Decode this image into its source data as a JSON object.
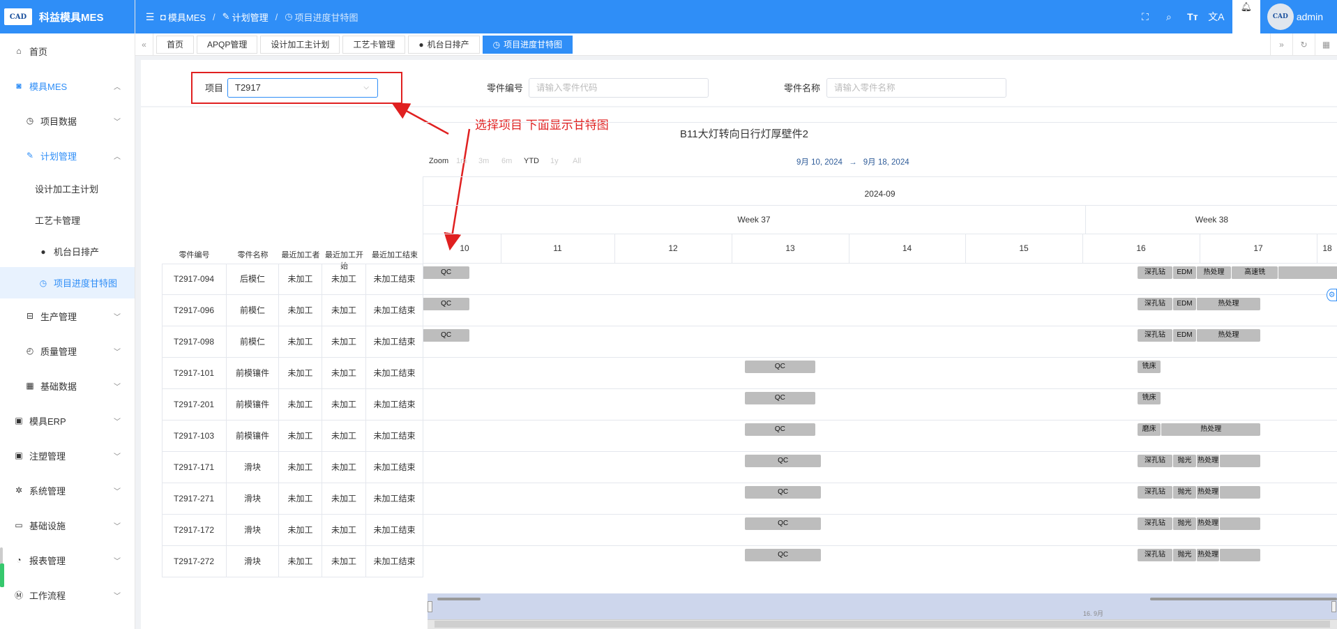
{
  "app": {
    "logo_text": "CAD",
    "logo_sub": "科益模具MES"
  },
  "sidebar": {
    "items": [
      {
        "label": "首页",
        "icon": "home-icon"
      },
      {
        "label": "模具MES",
        "icon": "camera-icon"
      },
      {
        "label": "项目数据",
        "icon": "clock-icon"
      },
      {
        "label": "计划管理",
        "icon": "edit-icon"
      },
      {
        "label": "设计加工主计划"
      },
      {
        "label": "工艺卡管理"
      },
      {
        "label": "机台日排产",
        "icon": "user-icon"
      },
      {
        "label": "项目进度甘特图",
        "icon": "clock-icon"
      },
      {
        "label": "生产管理",
        "icon": "toolbox-icon"
      },
      {
        "label": "质量管理",
        "icon": "timer-icon"
      },
      {
        "label": "基础数据",
        "icon": "calendar-icon"
      },
      {
        "label": "模具ERP",
        "icon": "bag-icon"
      },
      {
        "label": "注塑管理",
        "icon": "bag-icon"
      },
      {
        "label": "系统管理",
        "icon": "gear-icon"
      },
      {
        "label": "基础设施",
        "icon": "monitor-icon"
      },
      {
        "label": "报表管理",
        "icon": "pie-icon"
      },
      {
        "label": "工作流程",
        "icon": "flow-icon"
      }
    ]
  },
  "header": {
    "breadcrumb": [
      "模具MES",
      "计划管理",
      "项目进度甘特图"
    ],
    "user": "admin"
  },
  "tabs": [
    "首页",
    "APQP管理",
    "设计加工主计划",
    "工艺卡管理",
    "机台日排产",
    "项目进度甘特图"
  ],
  "filters": {
    "project_label": "项目",
    "project_value": "T2917",
    "part_no_label": "零件编号",
    "part_no_placeholder": "请输入零件代码",
    "part_name_label": "零件名称",
    "part_name_placeholder": "请输入零件名称"
  },
  "annotation": "选择项目 下面显示甘特图",
  "gantt": {
    "title": "B11大灯转向日行灯厚壁件2",
    "zoom_label": "Zoom",
    "zoom_options": [
      "1m",
      "3m",
      "6m",
      "YTD",
      "1y",
      "All"
    ],
    "zoom_active": "YTD",
    "range_from": "9月 10, 2024",
    "range_sep": "→",
    "range_to": "9月 18, 2024",
    "month_label": "2024-09",
    "weeks": [
      "Week 37",
      "Week 38"
    ],
    "days": [
      "10",
      "11",
      "12",
      "13",
      "14",
      "15",
      "16",
      "17",
      "18"
    ],
    "navigator_label": "16. 9月"
  },
  "table": {
    "headers": [
      "零件编号",
      "零件名称",
      "最近加工者",
      "最近加工开始",
      "最近加工结束"
    ],
    "rows": [
      [
        "T2917-094",
        "后模仁",
        "未加工",
        "未加工",
        "未加工结束"
      ],
      [
        "T2917-096",
        "前模仁",
        "未加工",
        "未加工",
        "未加工结束"
      ],
      [
        "T2917-098",
        "前模仁",
        "未加工",
        "未加工",
        "未加工结束"
      ],
      [
        "T2917-101",
        "前模镶件",
        "未加工",
        "未加工",
        "未加工结束"
      ],
      [
        "T2917-201",
        "前模镶件",
        "未加工",
        "未加工",
        "未加工结束"
      ],
      [
        "T2917-103",
        "前模镶件",
        "未加工",
        "未加工",
        "未加工结束"
      ],
      [
        "T2917-171",
        "滑块",
        "未加工",
        "未加工",
        "未加工结束"
      ],
      [
        "T2917-271",
        "滑块",
        "未加工",
        "未加工",
        "未加工结束"
      ],
      [
        "T2917-172",
        "滑块",
        "未加工",
        "未加工",
        "未加工结束"
      ],
      [
        "T2917-272",
        "滑块",
        "未加工",
        "未加工",
        "未加工结束"
      ]
    ]
  },
  "bars": [
    {
      "row": 0,
      "tasks": [
        {
          "label": "QC",
          "start": 10.0,
          "end": 10.4
        },
        {
          "label": "深孔钻",
          "start": 16.1,
          "end": 16.4
        },
        {
          "label": "EDM",
          "start": 16.4,
          "end": 16.6
        },
        {
          "label": "热处理",
          "start": 16.6,
          "end": 16.9
        },
        {
          "label": "高速铣",
          "start": 16.9,
          "end": 17.3
        },
        {
          "label": "",
          "start": 17.3,
          "end": 18.2
        }
      ]
    },
    {
      "row": 1,
      "tasks": [
        {
          "label": "QC",
          "start": 10.0,
          "end": 10.4
        },
        {
          "label": "深孔钻",
          "start": 16.1,
          "end": 16.4
        },
        {
          "label": "EDM",
          "start": 16.4,
          "end": 16.6
        },
        {
          "label": "热处理",
          "start": 16.6,
          "end": 17.15
        }
      ]
    },
    {
      "row": 2,
      "tasks": [
        {
          "label": "QC",
          "start": 10.0,
          "end": 10.4
        },
        {
          "label": "深孔钻",
          "start": 16.1,
          "end": 16.4
        },
        {
          "label": "EDM",
          "start": 16.4,
          "end": 16.6
        },
        {
          "label": "热处理",
          "start": 16.6,
          "end": 17.15
        }
      ]
    },
    {
      "row": 3,
      "tasks": [
        {
          "label": "QC",
          "start": 12.75,
          "end": 13.35
        },
        {
          "label": "铣床",
          "start": 16.1,
          "end": 16.3
        }
      ]
    },
    {
      "row": 4,
      "tasks": [
        {
          "label": "QC",
          "start": 12.75,
          "end": 13.35
        },
        {
          "label": "铣床",
          "start": 16.1,
          "end": 16.3
        }
      ]
    },
    {
      "row": 5,
      "tasks": [
        {
          "label": "QC",
          "start": 12.75,
          "end": 13.35
        },
        {
          "label": "磨床",
          "start": 16.1,
          "end": 16.3
        },
        {
          "label": "热处理",
          "start": 16.3,
          "end": 17.15
        }
      ]
    },
    {
      "row": 6,
      "tasks": [
        {
          "label": "QC",
          "start": 12.75,
          "end": 13.4
        },
        {
          "label": "深孔钻",
          "start": 16.1,
          "end": 16.4
        },
        {
          "label": "抛光",
          "start": 16.4,
          "end": 16.6
        },
        {
          "label": "热处理",
          "start": 16.6,
          "end": 16.8
        },
        {
          "label": "",
          "start": 16.8,
          "end": 17.15
        }
      ]
    },
    {
      "row": 7,
      "tasks": [
        {
          "label": "QC",
          "start": 12.75,
          "end": 13.4
        },
        {
          "label": "深孔钻",
          "start": 16.1,
          "end": 16.4
        },
        {
          "label": "抛光",
          "start": 16.4,
          "end": 16.6
        },
        {
          "label": "热处理",
          "start": 16.6,
          "end": 16.8
        },
        {
          "label": "",
          "start": 16.8,
          "end": 17.15
        }
      ]
    },
    {
      "row": 8,
      "tasks": [
        {
          "label": "QC",
          "start": 12.75,
          "end": 13.4
        },
        {
          "label": "深孔钻",
          "start": 16.1,
          "end": 16.4
        },
        {
          "label": "抛光",
          "start": 16.4,
          "end": 16.6
        },
        {
          "label": "热处理",
          "start": 16.6,
          "end": 16.8
        },
        {
          "label": "",
          "start": 16.8,
          "end": 17.15
        }
      ]
    },
    {
      "row": 9,
      "tasks": [
        {
          "label": "QC",
          "start": 12.75,
          "end": 13.4
        },
        {
          "label": "深孔钻",
          "start": 16.1,
          "end": 16.4
        },
        {
          "label": "抛光",
          "start": 16.4,
          "end": 16.6
        },
        {
          "label": "热处理",
          "start": 16.6,
          "end": 16.8
        },
        {
          "label": "",
          "start": 16.8,
          "end": 17.15
        }
      ]
    }
  ],
  "colors": {
    "brand": "#2f8ef7",
    "annotation": "#e02020",
    "bar": "#bdbdbd"
  }
}
